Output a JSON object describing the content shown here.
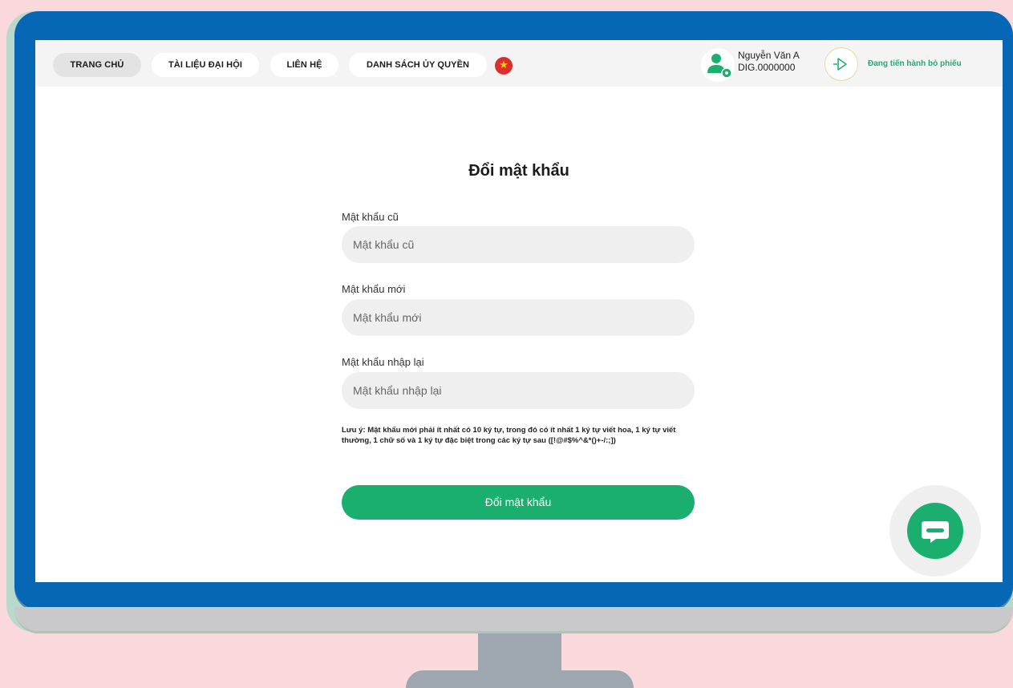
{
  "nav": {
    "items": [
      "TRANG CHỦ",
      "TÀI LIỆU ĐẠI HỘI",
      "LIÊN HỆ",
      "DANH SÁCH ỦY QUYỀN"
    ],
    "active_index": 0,
    "language_flag_icon": "vietnam-flag-icon"
  },
  "user": {
    "name": "Nguyễn Văn A",
    "id": "DIG.0000000",
    "avatar_icon": "user-settings-icon"
  },
  "vote_action": {
    "label": "Đang tiến hành bỏ phiếu",
    "icon": "vote-arrow-icon"
  },
  "form": {
    "title": "Đổi mật khẩu",
    "fields": [
      {
        "label": "Mật khẩu cũ",
        "placeholder": "Mật khẩu cũ",
        "value": ""
      },
      {
        "label": "Mật khẩu mới",
        "placeholder": "Mật khẩu mới",
        "value": ""
      },
      {
        "label": "Mật khẩu nhập lại",
        "placeholder": "Mật khẩu nhập lại",
        "value": ""
      }
    ],
    "note": "Lưu ý: Mật khẩu mới phải ít nhất có 10 ký tự, trong đó có ít nhất 1 ký tự viết hoa, 1 ký tự viết thường, 1 chữ số và 1 ký tự đặc biệt trong các ký tự sau ([!@#$%^&*()+-/:;])",
    "submit_label": "Đổi mật khẩu"
  },
  "chat": {
    "icon": "chat-bubble-icon"
  },
  "colors": {
    "accent_green": "#1aae6f",
    "monitor_blue": "#0668b4",
    "background_pink": "#f9d9dc"
  }
}
